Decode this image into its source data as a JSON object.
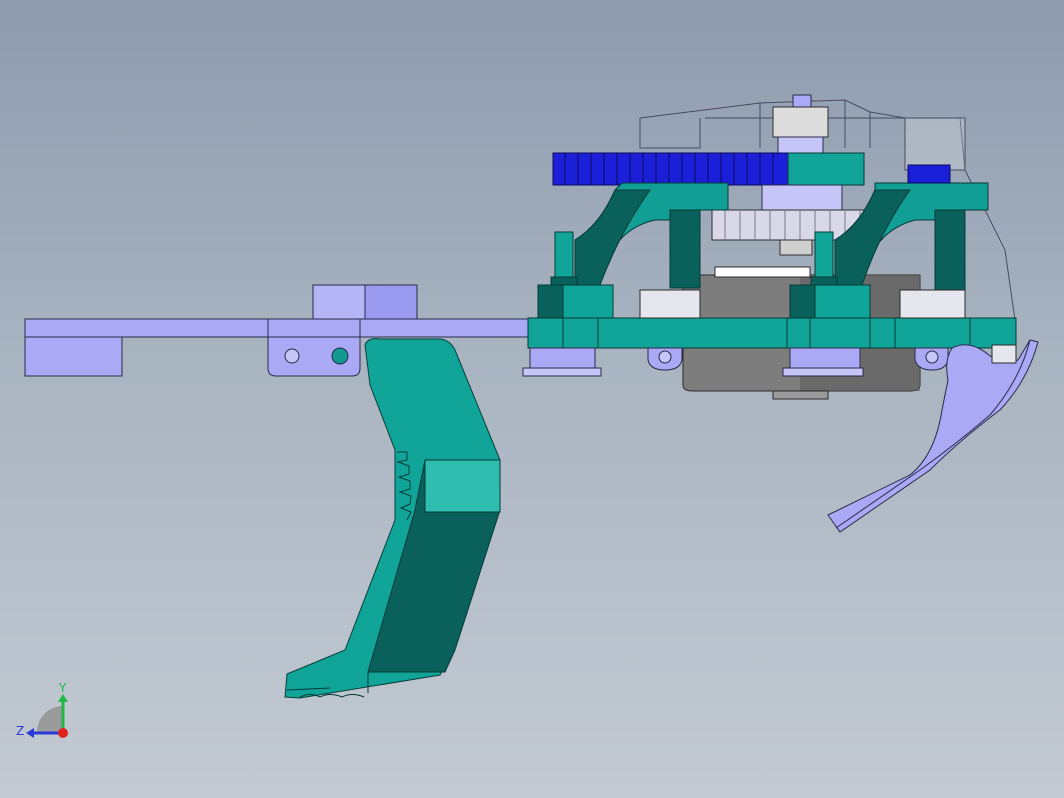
{
  "app": {
    "view": "cad-3d-viewport"
  },
  "triad": {
    "y_label": "Y",
    "z_label": "Z",
    "x_dot_color": "#e0221f",
    "y_color": "#22b845",
    "z_color": "#2a3bd6"
  },
  "colors": {
    "background_top": "#8d9bad",
    "background_bottom": "#c3cad3",
    "teal": "#119e94",
    "teal_dark": "#0a5f59",
    "teal_light": "#29bfb2",
    "lavender": "#a9a9f5",
    "gear_blue": "#1b20d8",
    "grey": "#7a7a7a"
  }
}
